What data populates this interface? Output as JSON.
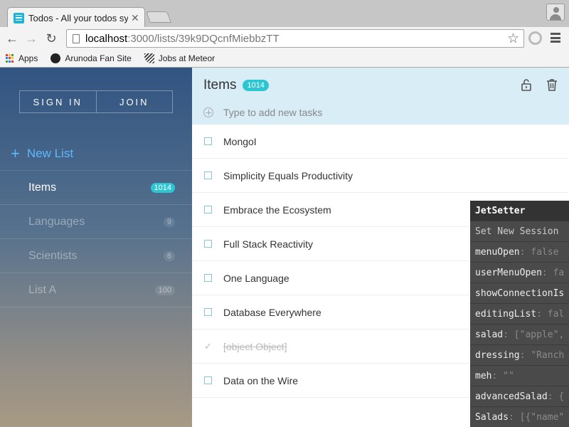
{
  "browser": {
    "tab_title": "Todos - All your todos syn",
    "url_host": "localhost",
    "url_path": ":3000/lists/39k9DQcnfMiebbzTT",
    "bookmarks": [
      {
        "label": "Apps",
        "icon": "apps-icon"
      },
      {
        "label": "Arunoda Fan Site",
        "icon": "github-icon"
      },
      {
        "label": "Jobs at Meteor",
        "icon": "meteor-icon"
      }
    ]
  },
  "sidebar": {
    "sign_in": "SIGN IN",
    "join": "JOIN",
    "new_list": "New List",
    "lists": [
      {
        "name": "Items",
        "count": "1014",
        "active": true
      },
      {
        "name": "Languages",
        "count": "9",
        "active": false
      },
      {
        "name": "Scientists",
        "count": "6",
        "active": false
      },
      {
        "name": "List A",
        "count": "100",
        "active": false
      }
    ]
  },
  "main": {
    "title": "Items",
    "count": "1014",
    "add_placeholder": "Type to add new tasks",
    "todos": [
      {
        "text": "MongoI",
        "done": false
      },
      {
        "text": "Simplicity Equals Productivity",
        "done": false
      },
      {
        "text": "Embrace the Ecosystem",
        "done": false
      },
      {
        "text": "Full Stack Reactivity",
        "done": false
      },
      {
        "text": "One Language",
        "done": false
      },
      {
        "text": "Database Everywhere",
        "done": false
      },
      {
        "text": "[object Object]",
        "done": true
      },
      {
        "text": "Data on the Wire",
        "done": false
      }
    ]
  },
  "jetsetter": {
    "title": "JetSetter",
    "new_session": "Set New Session",
    "vars": [
      {
        "key": "menuOpen",
        "value": ": false"
      },
      {
        "key": "userMenuOpen",
        "value": ": fa"
      },
      {
        "key": "showConnectionIs",
        "value": ""
      },
      {
        "key": "editingList",
        "value": ": fal"
      },
      {
        "key": "salad",
        "value": ": [\"apple\","
      },
      {
        "key": "dressing",
        "value": ": \"Ranch"
      },
      {
        "key": "meh",
        "value": ": \"\""
      },
      {
        "key": "advancedSalad",
        "value": ": {"
      },
      {
        "key": "Salads",
        "value": ": [{\"name\""
      }
    ]
  },
  "colors": {
    "accent_teal": "#2cc5d2",
    "new_list_blue": "#5db9ff",
    "header_bg": "#d8edf5"
  }
}
